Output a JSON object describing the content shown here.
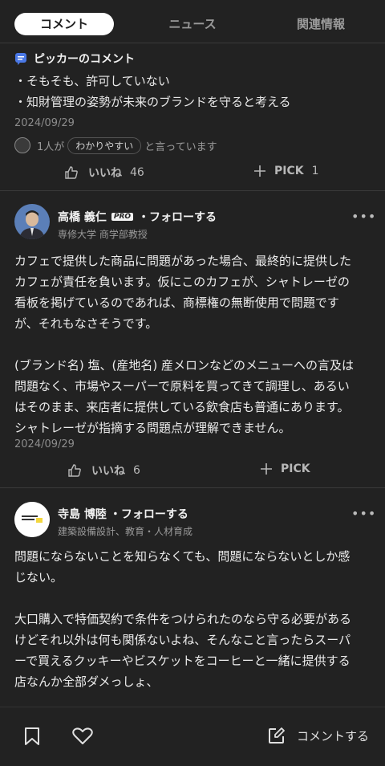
{
  "tabs": [
    {
      "label": "コメント",
      "active": true
    },
    {
      "label": "ニュース",
      "active": false
    },
    {
      "label": "関連情報",
      "active": false
    }
  ],
  "section": {
    "title": "ピッカーのコメント"
  },
  "comment0": {
    "lines": [
      "・そもそも、許可していない",
      "・知財管理の姿勢が未来のブランドを守ると考える"
    ],
    "date": "2024/09/29",
    "reaction": {
      "prefix": "1人が",
      "tag": "わかりやすい",
      "suffix": "と言っています"
    },
    "like": {
      "label": "いいね",
      "count": "46"
    },
    "pick": {
      "label": "PICK",
      "count": "1"
    }
  },
  "comment1": {
    "name": "高橋 義仁",
    "badge": "PRO",
    "follow": "・フォローする",
    "affiliation": "専修大学 商学部教授",
    "more": "•••",
    "lines": [
      "カフェで提供した商品に問題があった場合、最終的に提供した",
      "カフェが責任を負います。仮にこのカフェが、シャトレーゼの",
      "看板を掲げているのであれば、商標権の無断使用で問題です",
      "が、それもなさそうです。",
      "",
      "(ブランド名) 塩、(産地名) 産メロンなどのメニューへの言及は",
      "問題なく、市場やスーパーで原料を買ってきて調理し、あるい",
      "はそのまま、来店者に提供している飲食店も普通にあります。",
      "シャトレーゼが指摘する問題点が理解できません。"
    ],
    "date": "2024/09/29",
    "like": {
      "label": "いいね",
      "count": "6"
    },
    "pick": {
      "label": "PICK"
    }
  },
  "comment2": {
    "name": "寺島 博陸",
    "follow": "・フォローする",
    "affiliation": "建築設備設計、教育・人材育成",
    "more": "•••",
    "lines": [
      "問題にならないことを知らなくても、問題にならないとしか感",
      "じない。",
      "",
      "大口購入で特価契約で条件をつけられたのなら守る必要がある",
      "けどそれ以外は何も関係ないよね、そんなこと言ったらスーパ",
      "ーで買えるクッキーやビスケットをコーヒーと一緒に提供する",
      "店なんか全部ダメっしょ、"
    ]
  },
  "bottom_bar": {
    "comment_label": "コメントする"
  },
  "colors": {
    "background": "#222222",
    "accent_icon": "#4a78e6"
  }
}
